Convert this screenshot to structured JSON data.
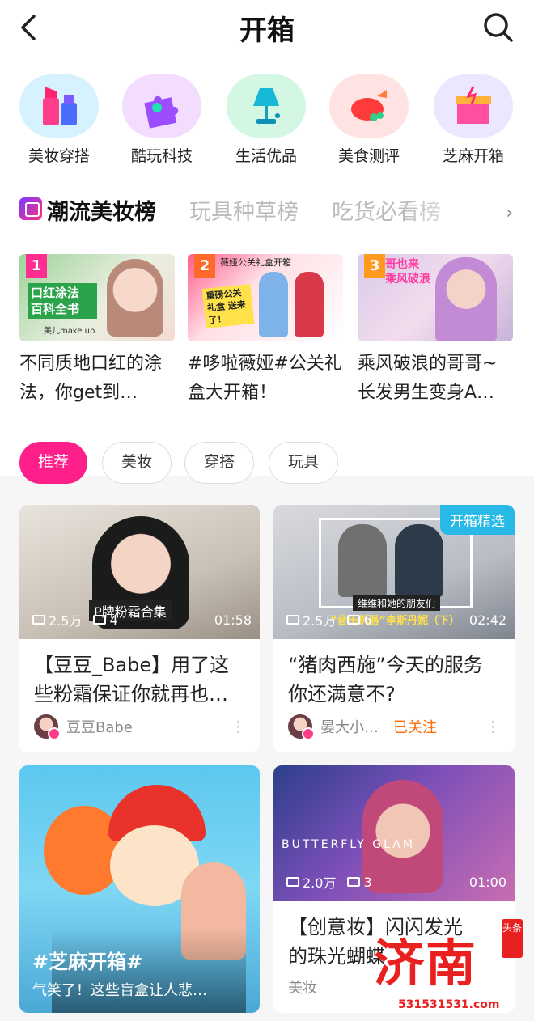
{
  "header": {
    "title": "开箱"
  },
  "categories": [
    {
      "label": "美妆穿搭",
      "icon": "lipstick-icon",
      "bg": "#d7f2ff"
    },
    {
      "label": "酷玩科技",
      "icon": "puzzle-icon",
      "bg": "#f3ddff"
    },
    {
      "label": "生活优品",
      "icon": "lamp-icon",
      "bg": "#d4f7e3"
    },
    {
      "label": "美食测评",
      "icon": "roast-chicken-icon",
      "bg": "#ffe3e3"
    },
    {
      "label": "芝麻开箱",
      "icon": "gift-box-icon",
      "bg": "#ece6ff"
    }
  ],
  "rank_tabs": [
    "潮流美妆榜",
    "玩具种草榜",
    "吃货必看榜"
  ],
  "rank_cards": [
    {
      "rank": "1",
      "title": "不同质地口红的涂法，你get到…",
      "badge_color": "#ff2d8f",
      "thumb_text": "口红涂法 百科全书",
      "thumb_sub": "美儿make up"
    },
    {
      "rank": "2",
      "title": "#哆啦薇娅#公关礼盒大开箱！",
      "badge_color": "#ff6a2b",
      "thumb_text": "薇娅公关礼盒开箱",
      "thumb_sub": "重磅公关礼盒 送来了！"
    },
    {
      "rank": "3",
      "title": "乘风破浪的哥哥~长发男生变身A…",
      "badge_color": "#ff9a1f",
      "thumb_text": "哥也来 乘风破浪",
      "thumb_sub": ""
    }
  ],
  "filters": [
    "推荐",
    "美妆",
    "穿搭",
    "玩具"
  ],
  "feed": [
    {
      "title": "【豆豆_Babe】用了这些粉霜保证你就再也…",
      "views": "2.5万",
      "comments": "4",
      "duration": "01:58",
      "author": "豆豆Babe",
      "overlay": "P牌粉霜合集"
    },
    {
      "title": "“猪肉西施”今天的服务你还满意不?",
      "views": "2.5万",
      "comments": "6",
      "duration": "02:42",
      "author": "晏大小…",
      "follow": "已关注",
      "tag": "开箱精选",
      "overlay": "维维和她的朋友们",
      "overlay2": "“音乐机器”李斯丹妮（下）"
    },
    {
      "title_overlay": "#芝麻开箱#",
      "sub_overlay": "气笑了！这些盲盒让人悲…"
    },
    {
      "title": "【创意妆】闪闪发光的珠光蝴蝶",
      "views": "2.0万",
      "comments": "3",
      "duration": "01:00",
      "author": "美妆",
      "overlay": "BUTTERFLY GLAM"
    }
  ],
  "watermark": {
    "big": "济南",
    "url": "531531531.com",
    "seal": "头条"
  }
}
